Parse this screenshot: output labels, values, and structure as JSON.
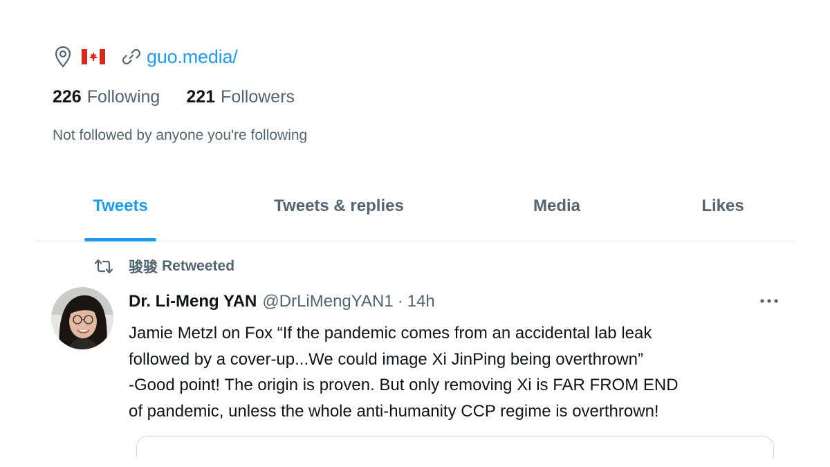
{
  "profile": {
    "website": "guo.media/",
    "following_count": "226",
    "following_label": "Following",
    "followers_count": "221",
    "followers_label": "Followers",
    "not_followed_text": "Not followed by anyone you're following",
    "location_icon": "location-pin-icon",
    "flag_icon": "canada-flag-icon",
    "link_icon": "link-icon"
  },
  "tabs": [
    {
      "label": "Tweets",
      "active": true
    },
    {
      "label": "Tweets & replies",
      "active": false
    },
    {
      "label": "Media",
      "active": false
    },
    {
      "label": "Likes",
      "active": false
    }
  ],
  "tweet": {
    "retweeter_name": "骏骏",
    "retweeted_label": "Retweeted",
    "author_name": "Dr. Li-Meng YAN",
    "author_handle": "@DrLiMengYAN1",
    "separator": "·",
    "time": "14h",
    "text": "Jamie Metzl on Fox “If the pandemic comes from an accidental lab leak\nfollowed by a cover-up...We could image Xi JinPing being overthrown”\n-Good point! The origin is proven. But only removing Xi is FAR FROM END\nof pandemic, unless the whole anti-humanity CCP regime is overthrown!"
  },
  "colors": {
    "accent": "#1d9bf0",
    "text_primary": "#0f1419",
    "text_secondary": "#536471",
    "flag_red": "#d52b1e"
  }
}
